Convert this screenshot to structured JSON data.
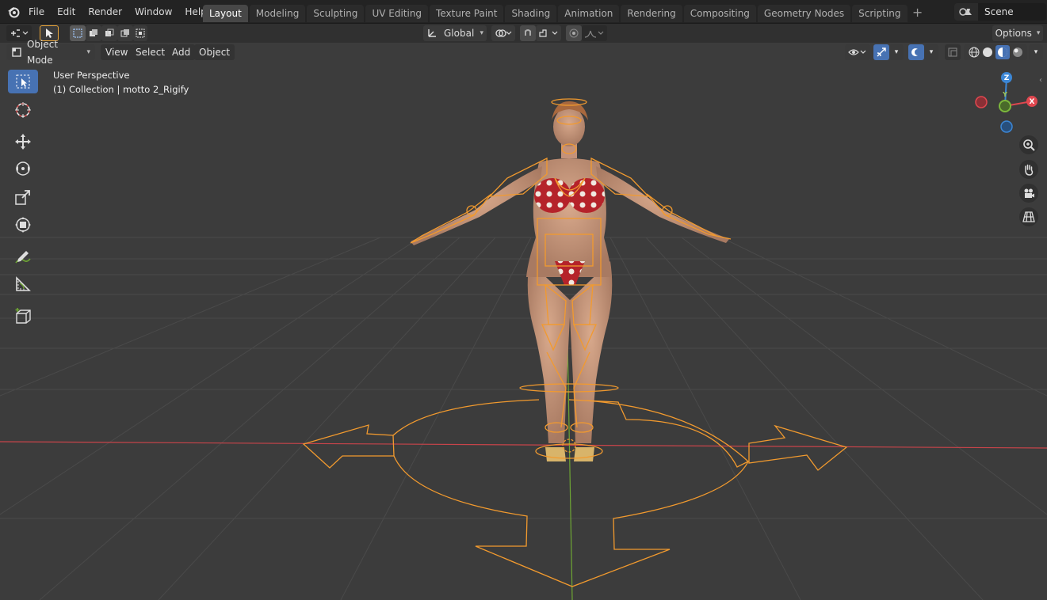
{
  "app": {
    "name": "Blender"
  },
  "menu": {
    "items": [
      "File",
      "Edit",
      "Render",
      "Window",
      "Help"
    ]
  },
  "workspaces": {
    "tabs": [
      "Layout",
      "Modeling",
      "Sculpting",
      "UV Editing",
      "Texture Paint",
      "Shading",
      "Animation",
      "Rendering",
      "Compositing",
      "Geometry Nodes",
      "Scripting"
    ],
    "active": "Layout",
    "add_label": "+"
  },
  "scene": {
    "name": "Scene"
  },
  "tool_header": {
    "transform_orientation": "Global",
    "options_label": "Options"
  },
  "viewport_header": {
    "mode": "Object Mode",
    "view": "View",
    "select": "Select",
    "add": "Add",
    "object": "Object"
  },
  "viewport": {
    "perspective_label": "User Perspective",
    "collection_label": "(1) Collection | motto 2_Rigify"
  },
  "gizmo": {
    "z": "Z",
    "x": "X",
    "y": "Y"
  },
  "icons": {
    "tools": [
      "select-box-icon",
      "cursor-icon",
      "move-icon",
      "rotate-icon",
      "scale-icon",
      "transform-icon",
      "annotate-icon",
      "measure-icon",
      "add-cube-icon"
    ],
    "nav": [
      "zoom-icon",
      "pan-hand-icon",
      "camera-icon",
      "grid-ortho-icon"
    ]
  },
  "colors": {
    "accent": "#4772b3",
    "rig": "#f29a2e",
    "x_axis": "#e0474f",
    "y_axis": "#7cb83c",
    "z_axis": "#3c87d6",
    "viewport_bg": "#3c3c3c"
  }
}
